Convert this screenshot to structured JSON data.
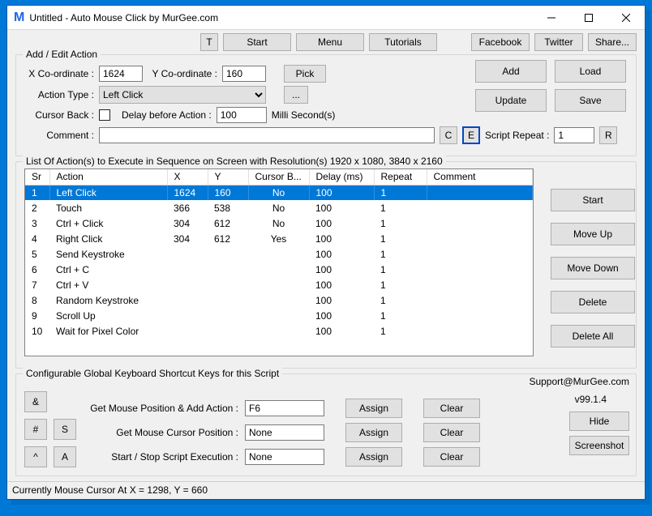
{
  "window": {
    "title": "Untitled - Auto Mouse Click by MurGee.com"
  },
  "toolbar": {
    "t": "T",
    "start": "Start",
    "menu": "Menu",
    "tutorials": "Tutorials",
    "facebook": "Facebook",
    "twitter": "Twitter",
    "share": "Share..."
  },
  "addedit": {
    "legend": "Add / Edit Action",
    "xlabel": "X Co-ordinate :",
    "xval": "1624",
    "ylabel": "Y Co-ordinate :",
    "yval": "160",
    "pick": "Pick",
    "actiontype_label": "Action Type :",
    "actiontype_value": "Left Click",
    "ellipsis": "...",
    "cursorback_label": "Cursor Back :",
    "delay_label": "Delay before Action :",
    "delay_val": "100",
    "ms": "Milli Second(s)",
    "comment_label": "Comment :",
    "comment_val": "",
    "c": "C",
    "e": "E",
    "scriptrepeat_label": "Script Repeat :",
    "scriptrepeat_val": "1",
    "r": "R"
  },
  "rightbtns": {
    "add": "Add",
    "load": "Load",
    "update": "Update",
    "save": "Save"
  },
  "list": {
    "legend": "List Of Action(s) to Execute in Sequence on Screen with Resolution(s) 1920 x 1080, 3840 x 2160",
    "headers": {
      "sr": "Sr",
      "action": "Action",
      "x": "X",
      "y": "Y",
      "cb": "Cursor B...",
      "delay": "Delay (ms)",
      "rep": "Repeat",
      "comment": "Comment"
    },
    "rows": [
      {
        "sr": "1",
        "action": "Left Click",
        "x": "1624",
        "y": "160",
        "cb": "No",
        "delay": "100",
        "rep": "1",
        "comment": ""
      },
      {
        "sr": "2",
        "action": "Touch",
        "x": "366",
        "y": "538",
        "cb": "No",
        "delay": "100",
        "rep": "1",
        "comment": ""
      },
      {
        "sr": "3",
        "action": "Ctrl + Click",
        "x": "304",
        "y": "612",
        "cb": "No",
        "delay": "100",
        "rep": "1",
        "comment": ""
      },
      {
        "sr": "4",
        "action": "Right Click",
        "x": "304",
        "y": "612",
        "cb": "Yes",
        "delay": "100",
        "rep": "1",
        "comment": ""
      },
      {
        "sr": "5",
        "action": "Send Keystroke",
        "x": "",
        "y": "",
        "cb": "",
        "delay": "100",
        "rep": "1",
        "comment": ""
      },
      {
        "sr": "6",
        "action": "Ctrl + C",
        "x": "",
        "y": "",
        "cb": "",
        "delay": "100",
        "rep": "1",
        "comment": ""
      },
      {
        "sr": "7",
        "action": "Ctrl + V",
        "x": "",
        "y": "",
        "cb": "",
        "delay": "100",
        "rep": "1",
        "comment": ""
      },
      {
        "sr": "8",
        "action": "Random Keystroke",
        "x": "",
        "y": "",
        "cb": "",
        "delay": "100",
        "rep": "1",
        "comment": ""
      },
      {
        "sr": "9",
        "action": "Scroll Up",
        "x": "",
        "y": "",
        "cb": "",
        "delay": "100",
        "rep": "1",
        "comment": ""
      },
      {
        "sr": "10",
        "action": "Wait for Pixel Color",
        "x": "",
        "y": "",
        "cb": "",
        "delay": "100",
        "rep": "1",
        "comment": ""
      }
    ]
  },
  "sidebtns": {
    "start": "Start",
    "moveup": "Move Up",
    "movedown": "Move Down",
    "delete": "Delete",
    "deleteall": "Delete All"
  },
  "config": {
    "legend": "Configurable Global Keyboard Shortcut Keys for this Script",
    "amp": "&",
    "hash": "#",
    "s": "S",
    "caret": "^",
    "a": "A",
    "row1": "Get Mouse Position & Add Action :",
    "v1": "F6",
    "row2": "Get Mouse Cursor Position :",
    "v2": "None",
    "row3": "Start / Stop Script Execution :",
    "v3": "None",
    "assign": "Assign",
    "clear": "Clear",
    "support": "Support@MurGee.com",
    "version": "v99.1.4",
    "hide": "Hide",
    "screenshot": "Screenshot"
  },
  "status": "Currently Mouse Cursor At X = 1298, Y = 660"
}
